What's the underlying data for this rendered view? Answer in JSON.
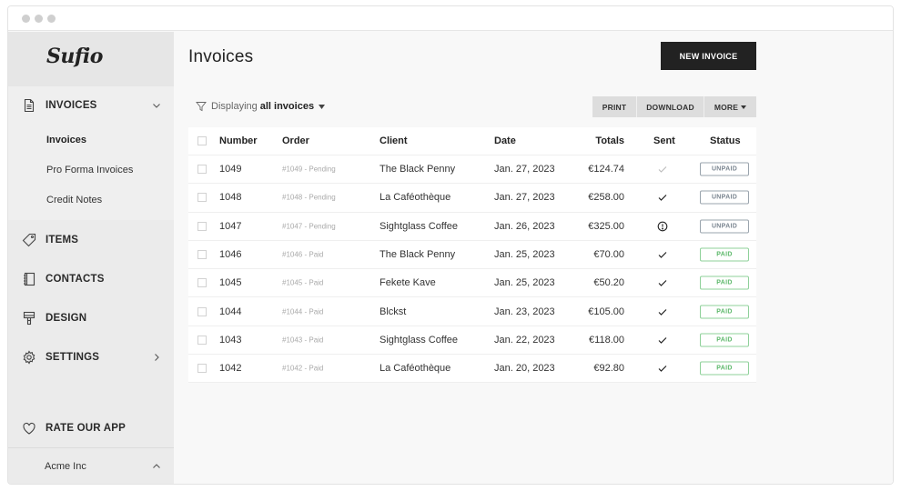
{
  "app": {
    "logo": "Sufio"
  },
  "sidebar": {
    "invoices_section": {
      "label": "INVOICES",
      "icon": "document-icon",
      "sub_items": [
        {
          "label": "Invoices",
          "active": true
        },
        {
          "label": "Pro Forma Invoices",
          "active": false
        },
        {
          "label": "Credit Notes",
          "active": false
        }
      ]
    },
    "items": [
      {
        "label": "ITEMS",
        "icon": "tag-icon"
      },
      {
        "label": "CONTACTS",
        "icon": "address-book-icon"
      },
      {
        "label": "DESIGN",
        "icon": "paint-roller-icon"
      },
      {
        "label": "SETTINGS",
        "icon": "gear-icon"
      }
    ],
    "rate": {
      "label": "RATE OUR APP",
      "icon": "heart-icon"
    },
    "account": {
      "label": "Acme Inc"
    }
  },
  "main": {
    "title": "Invoices",
    "new_invoice_label": "NEW INVOICE",
    "filter": {
      "prefix": "Displaying",
      "value": "all invoices"
    },
    "toolbar": {
      "print": "PRINT",
      "download": "DOWNLOAD",
      "more": "MORE"
    },
    "table": {
      "columns": [
        "Number",
        "Order",
        "Client",
        "Date",
        "Totals",
        "Sent",
        "Status"
      ],
      "rows": [
        {
          "number": "1049",
          "order": "#1049 - Pending",
          "client": "The Black Penny",
          "date": "Jan. 27, 2023",
          "total": "€124.74",
          "sent": "check-faded",
          "status": "UNPAID"
        },
        {
          "number": "1048",
          "order": "#1048 - Pending",
          "client": "La Caféothèque",
          "date": "Jan. 27, 2023",
          "total": "€258.00",
          "sent": "check",
          "status": "UNPAID"
        },
        {
          "number": "1047",
          "order": "#1047 - Pending",
          "client": "Sightglass Coffee",
          "date": "Jan. 26, 2023",
          "total": "€325.00",
          "sent": "alert",
          "status": "UNPAID"
        },
        {
          "number": "1046",
          "order": "#1046 - Paid",
          "client": "The Black Penny",
          "date": "Jan. 25, 2023",
          "total": "€70.00",
          "sent": "check",
          "status": "PAID"
        },
        {
          "number": "1045",
          "order": "#1045 - Paid",
          "client": "Fekete Kave",
          "date": "Jan. 25, 2023",
          "total": "€50.20",
          "sent": "check",
          "status": "PAID"
        },
        {
          "number": "1044",
          "order": "#1044 - Paid",
          "client": "Blckst",
          "date": "Jan. 23, 2023",
          "total": "€105.00",
          "sent": "check",
          "status": "PAID"
        },
        {
          "number": "1043",
          "order": "#1043 - Paid",
          "client": "Sightglass Coffee",
          "date": "Jan. 22, 2023",
          "total": "€118.00",
          "sent": "check",
          "status": "PAID"
        },
        {
          "number": "1042",
          "order": "#1042 - Paid",
          "client": "La Caféothèque",
          "date": "Jan. 20, 2023",
          "total": "€92.80",
          "sent": "check",
          "status": "PAID"
        }
      ]
    }
  },
  "colors": {
    "primary_button": "#222222",
    "paid": "#5cb86a",
    "unpaid": "#7a8590",
    "sidebar_bg": "#ebebeb"
  }
}
